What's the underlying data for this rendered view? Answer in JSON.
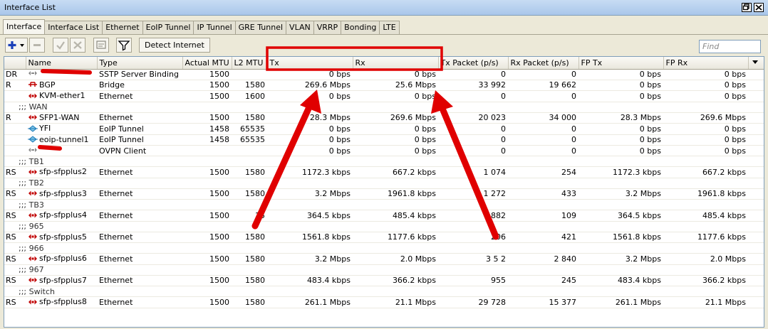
{
  "window": {
    "title": "Interface List"
  },
  "tabs": [
    "Interface",
    "Interface List",
    "Ethernet",
    "EoIP Tunnel",
    "IP Tunnel",
    "GRE Tunnel",
    "VLAN",
    "VRRP",
    "Bonding",
    "LTE"
  ],
  "toolbar": {
    "detect_label": "Detect Internet",
    "find_placeholder": "Find"
  },
  "columns": [
    "Name",
    "Type",
    "Actual MTU",
    "L2 MTU",
    "Tx",
    "Rx",
    "Tx Packet (p/s)",
    "Rx Packet (p/s)",
    "FP Tx",
    "FP Rx"
  ],
  "rows": [
    {
      "kind": "data",
      "flag": "DR",
      "icon": "dynamic-icon",
      "name": "",
      "redacted": true,
      "type": "SSTP Server Binding",
      "mtu": "1500",
      "l2mtu": "",
      "tx": "0 bps",
      "rx": "0 bps",
      "txp": "0",
      "rxp": "0",
      "fptx": "0 bps",
      "fprx": "0 bps"
    },
    {
      "kind": "data",
      "flag": "R",
      "icon": "bridge-icon",
      "name": "BGP",
      "type": "Bridge",
      "mtu": "1500",
      "l2mtu": "1580",
      "tx": "269.6 Mbps",
      "rx": "25.6 Mbps",
      "txp": "33 992",
      "rxp": "19 662",
      "fptx": "0 bps",
      "fprx": "0 bps"
    },
    {
      "kind": "data",
      "flag": "",
      "icon": "ethernet-icon",
      "name": "KVM-ether1",
      "type": "Ethernet",
      "mtu": "1500",
      "l2mtu": "1600",
      "tx": "0 bps",
      "rx": "0 bps",
      "txp": "0",
      "rxp": "0",
      "fptx": "0 bps",
      "fprx": "0 bps"
    },
    {
      "kind": "comment",
      "text": ";;; WAN"
    },
    {
      "kind": "data",
      "flag": "R",
      "icon": "ethernet-icon",
      "name": "SFP1-WAN",
      "type": "Ethernet",
      "mtu": "1500",
      "l2mtu": "1580",
      "tx": "28.3 Mbps",
      "rx": "269.6 Mbps",
      "txp": "20 023",
      "rxp": "34 000",
      "fptx": "28.3 Mbps",
      "fprx": "269.6 Mbps"
    },
    {
      "kind": "data",
      "flag": "",
      "icon": "tunnel-icon",
      "name": "YFI",
      "type": "EoIP Tunnel",
      "mtu": "1458",
      "l2mtu": "65535",
      "tx": "0 bps",
      "rx": "0 bps",
      "txp": "0",
      "rxp": "0",
      "fptx": "0 bps",
      "fprx": "0 bps"
    },
    {
      "kind": "data",
      "flag": "",
      "icon": "tunnel-icon",
      "name": "eoip-tunnel1",
      "type": "EoIP Tunnel",
      "mtu": "1458",
      "l2mtu": "65535",
      "tx": "0 bps",
      "rx": "0 bps",
      "txp": "0",
      "rxp": "0",
      "fptx": "0 bps",
      "fprx": "0 bps"
    },
    {
      "kind": "data",
      "flag": "",
      "icon": "dynamic-icon",
      "name": "",
      "redacted": true,
      "type": "OVPN Client",
      "mtu": "",
      "l2mtu": "",
      "tx": "0 bps",
      "rx": "0 bps",
      "txp": "0",
      "rxp": "0",
      "fptx": "0 bps",
      "fprx": "0 bps"
    },
    {
      "kind": "comment",
      "text": ";;; TB1"
    },
    {
      "kind": "data",
      "flag": "RS",
      "icon": "ethernet-icon",
      "name": "sfp-sfpplus2",
      "type": "Ethernet",
      "mtu": "1500",
      "l2mtu": "1580",
      "tx": "1172.3 kbps",
      "rx": "667.2 kbps",
      "txp": "1 074",
      "rxp": "254",
      "fptx": "1172.3 kbps",
      "fprx": "667.2 kbps"
    },
    {
      "kind": "comment",
      "text": ";;; TB2"
    },
    {
      "kind": "data",
      "flag": "RS",
      "icon": "ethernet-icon",
      "name": "sfp-sfpplus3",
      "type": "Ethernet",
      "mtu": "1500",
      "l2mtu": "1580",
      "tx": "3.2 Mbps",
      "rx": "1961.8 kbps",
      "txp": "1 272",
      "rxp": "433",
      "fptx": "3.2 Mbps",
      "fprx": "1961.8 kbps"
    },
    {
      "kind": "comment",
      "text": ";;; TB3"
    },
    {
      "kind": "data",
      "flag": "RS",
      "icon": "ethernet-icon",
      "name": "sfp-sfpplus4",
      "type": "Ethernet",
      "mtu": "1500",
      "l2mtu": "15",
      "tx": "364.5 kbps",
      "rx": "485.4 kbps",
      "txp": "882",
      "rxp": "109",
      "fptx": "364.5 kbps",
      "fprx": "485.4 kbps"
    },
    {
      "kind": "comment",
      "text": ";;; 965"
    },
    {
      "kind": "data",
      "flag": "RS",
      "icon": "ethernet-icon",
      "name": "sfp-sfpplus5",
      "type": "Ethernet",
      "mtu": "1500",
      "l2mtu": "1580",
      "tx": "1561.8 kbps",
      "rx": "1177.6 kbps",
      "txp": "206",
      "rxp": "421",
      "fptx": "1561.8 kbps",
      "fprx": "1177.6 kbps"
    },
    {
      "kind": "comment",
      "text": ";;; 966"
    },
    {
      "kind": "data",
      "flag": "RS",
      "icon": "ethernet-icon",
      "name": "sfp-sfpplus6",
      "type": "Ethernet",
      "mtu": "1500",
      "l2mtu": "1580",
      "tx": "3.2 Mbps",
      "rx": "2.0 Mbps",
      "txp": "3 5 2",
      "rxp": "2 840",
      "fptx": "3.2 Mbps",
      "fprx": "2.0 Mbps"
    },
    {
      "kind": "comment",
      "text": ";;; 967"
    },
    {
      "kind": "data",
      "flag": "RS",
      "icon": "ethernet-icon",
      "name": "sfp-sfpplus7",
      "type": "Ethernet",
      "mtu": "1500",
      "l2mtu": "1580",
      "tx": "483.4 kbps",
      "rx": "366.2 kbps",
      "txp": "955",
      "rxp": "245",
      "fptx": "483.4 kbps",
      "fprx": "366.2 kbps"
    },
    {
      "kind": "comment",
      "text": ";;; Switch"
    },
    {
      "kind": "data",
      "flag": "RS",
      "icon": "ethernet-icon",
      "name": "sfp-sfpplus8",
      "type": "Ethernet",
      "mtu": "1500",
      "l2mtu": "1580",
      "tx": "261.1 Mbps",
      "rx": "21.1 Mbps",
      "txp": "29 728",
      "rxp": "15 377",
      "fptx": "261.1 Mbps",
      "fprx": "21.1 Mbps"
    }
  ],
  "annotations": {
    "highlight_color": "#e00000",
    "redaction_color": "#e00000"
  }
}
